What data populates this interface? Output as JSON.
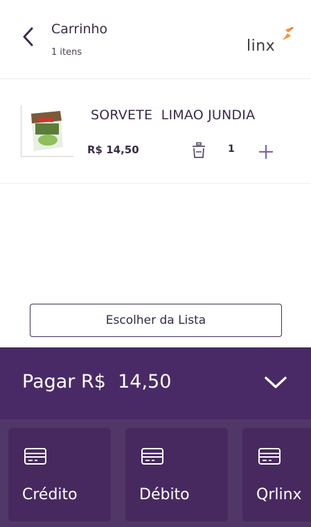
{
  "header": {
    "title": "Carrinho",
    "subtitle": "1 itens",
    "brand": "Linx",
    "back_icon": "chevron-left-icon"
  },
  "cart": {
    "items": [
      {
        "name": "SORVETE  LIMAO JUNDIA",
        "price": "R$  14,50",
        "quantity": "1",
        "remove_icon": "trash-icon",
        "increase_icon": "plus-icon"
      }
    ]
  },
  "actions": {
    "choose_list_label": "Escolher da Lista"
  },
  "payment": {
    "label": "Pagar R$  14,50",
    "toggle_icon": "chevron-down-icon",
    "methods": [
      {
        "label": "Crédito",
        "icon": "card-icon"
      },
      {
        "label": "Débito",
        "icon": "card-icon"
      },
      {
        "label": "Qrlinx",
        "icon": "card-icon"
      }
    ]
  },
  "colors": {
    "brand_purple": "#4a2a66",
    "methods_bg": "#513668",
    "card_bg": "#47295f",
    "accent_plus": "#7b5ea6",
    "logo_orange": "#f0923a"
  }
}
